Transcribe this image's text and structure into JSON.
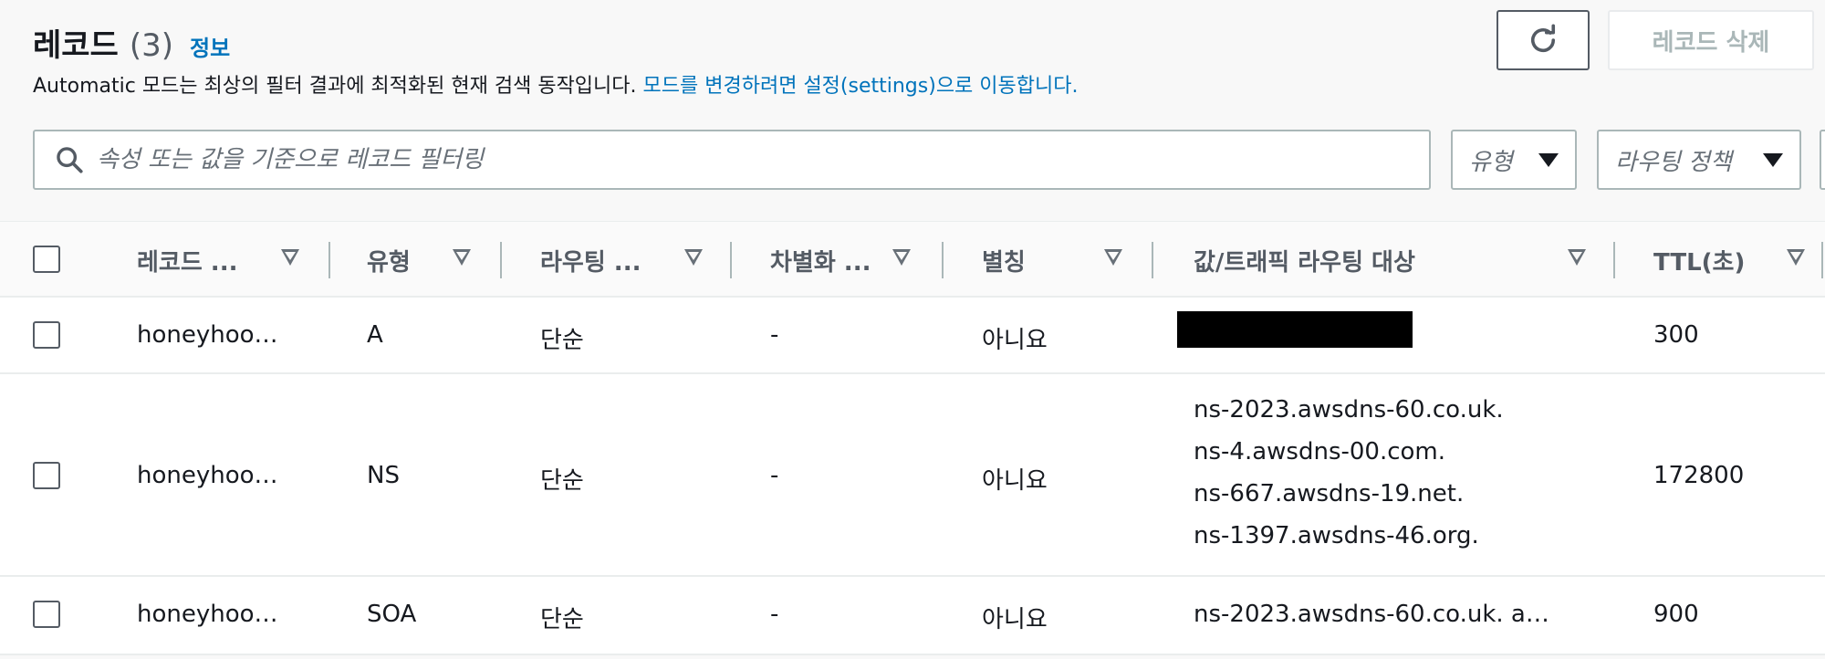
{
  "header": {
    "title": "레코드",
    "count": "(3)",
    "info_link": "정보",
    "description": "Automatic 모드는 최상의 필터 결과에 최적화된 현재 검색 동작입니다.",
    "settings_link": "모드를 변경하려면 설정(settings)으로 이동합니다."
  },
  "toolbar": {
    "refresh_icon": "refresh-icon",
    "delete_label": "레코드 삭제"
  },
  "filter": {
    "search_placeholder": "속성 또는 값을 기준으로 레코드 필터링",
    "type_dropdown": "유형",
    "routing_dropdown": "라우팅 정책"
  },
  "table": {
    "columns": [
      "레코드 ...",
      "유형",
      "라우팅 ...",
      "차별화 ...",
      "별칭",
      "값/트래픽 라우팅 대상",
      "TTL(초)"
    ],
    "rows": [
      {
        "name": "honeyhoo…",
        "type": "A",
        "routing": "단순",
        "differentiator": "-",
        "alias": "아니요",
        "values": [],
        "ttl": "300"
      },
      {
        "name": "honeyhoo…",
        "type": "NS",
        "routing": "단순",
        "differentiator": "-",
        "alias": "아니요",
        "values": [
          "ns-2023.awsdns-60.co.uk.",
          "ns-4.awsdns-00.com.",
          "ns-667.awsdns-19.net.",
          "ns-1397.awsdns-46.org."
        ],
        "ttl": "172800"
      },
      {
        "name": "honeyhoo…",
        "type": "SOA",
        "routing": "단순",
        "differentiator": "-",
        "alias": "아니요",
        "values": [
          "ns-2023.awsdns-60.co.uk. a…"
        ],
        "ttl": "900"
      }
    ]
  },
  "colors": {
    "link": "#0073bb",
    "text": "#16191f",
    "muted": "#545b64",
    "disabled": "#aab7b8",
    "background": "#f8f8f8"
  }
}
